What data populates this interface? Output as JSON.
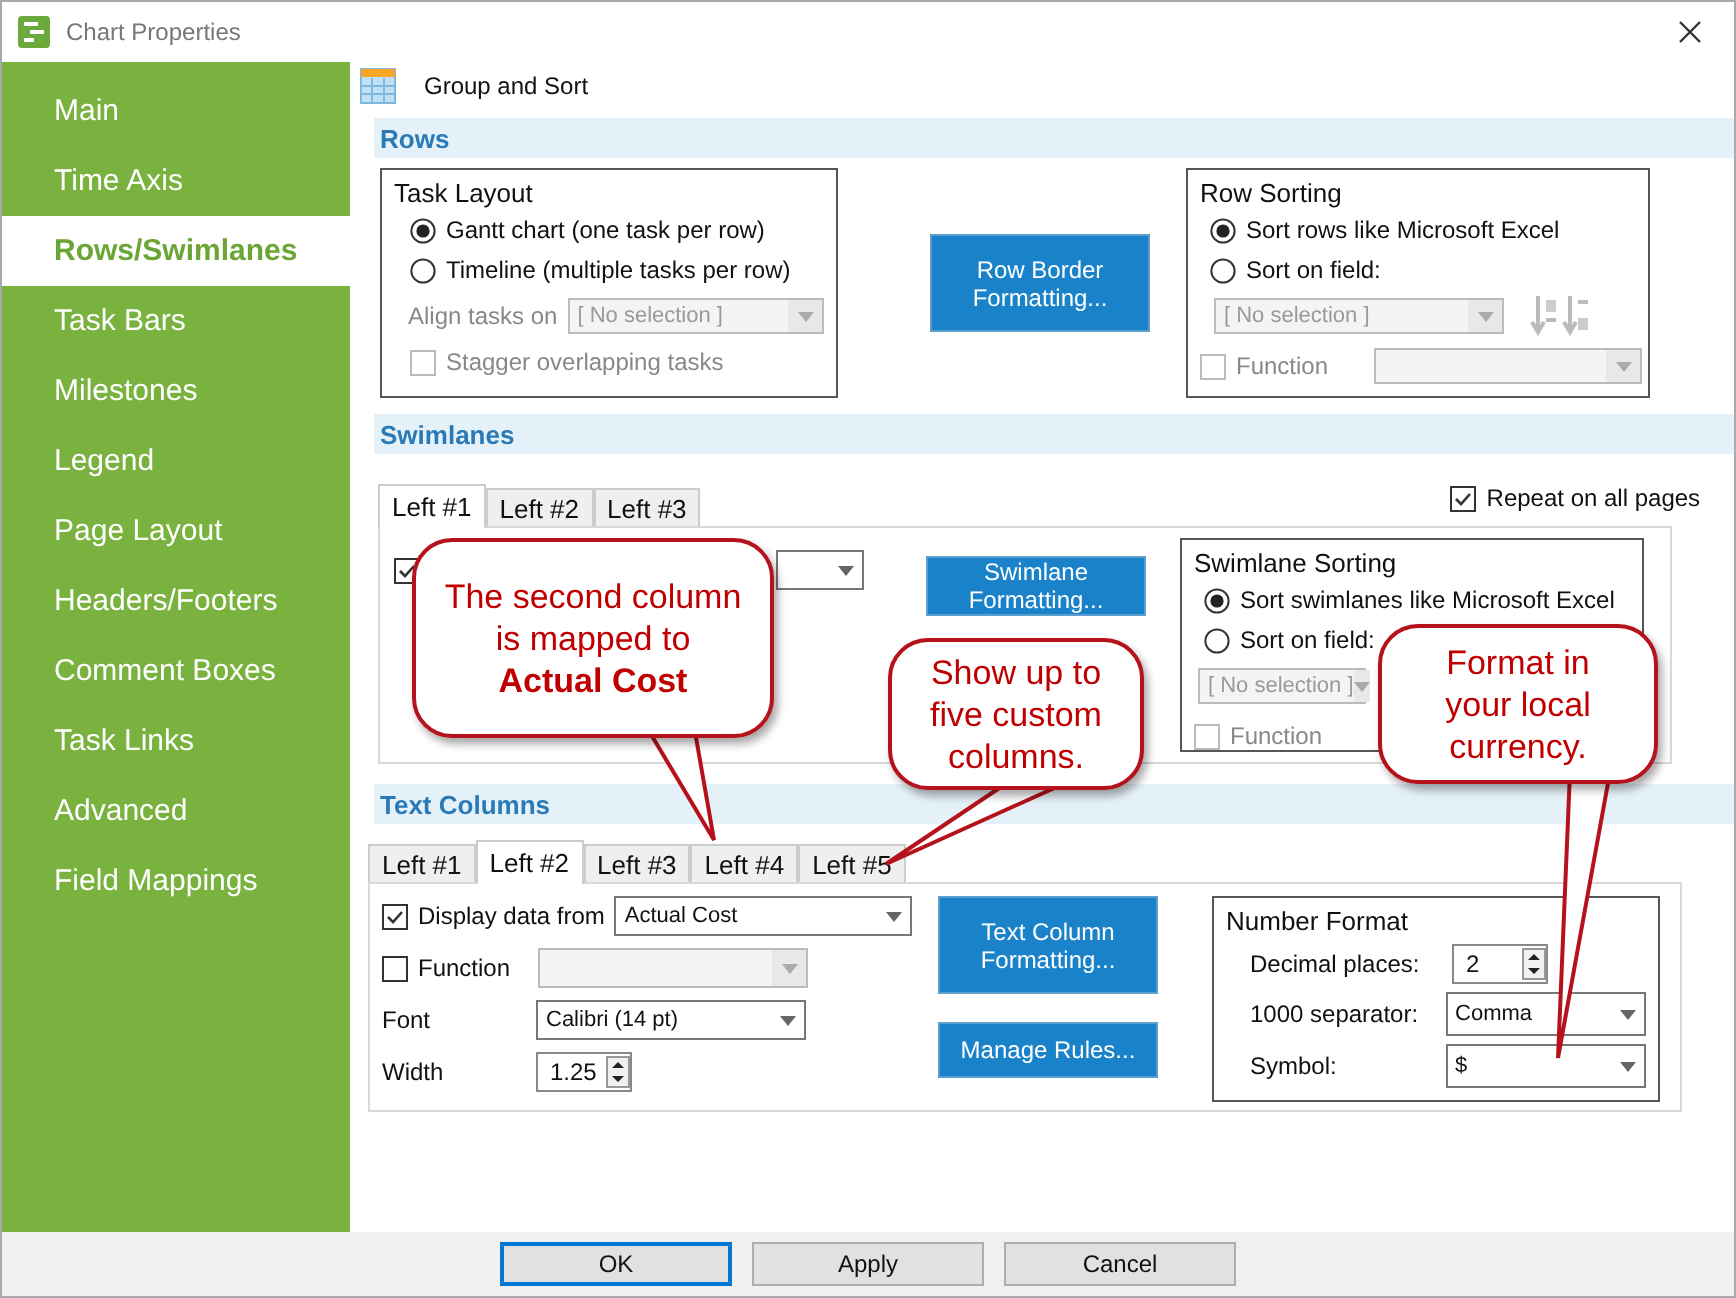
{
  "window": {
    "title": "Chart Properties"
  },
  "sidebar": {
    "items": [
      {
        "label": "Main",
        "selected": false
      },
      {
        "label": "Time Axis",
        "selected": false
      },
      {
        "label": "Rows/Swimlanes",
        "selected": true
      },
      {
        "label": "Task Bars",
        "selected": false
      },
      {
        "label": "Milestones",
        "selected": false
      },
      {
        "label": "Legend",
        "selected": false
      },
      {
        "label": "Page Layout",
        "selected": false
      },
      {
        "label": "Headers/Footers",
        "selected": false
      },
      {
        "label": "Comment Boxes",
        "selected": false
      },
      {
        "label": "Task Links",
        "selected": false
      },
      {
        "label": "Advanced",
        "selected": false
      },
      {
        "label": "Field Mappings",
        "selected": false
      }
    ]
  },
  "page_header": {
    "title": "Group and Sort"
  },
  "rows": {
    "title": "Rows",
    "task_layout": {
      "title": "Task Layout",
      "options": [
        {
          "label": "Gantt chart (one task per row)",
          "selected": true
        },
        {
          "label": "Timeline (multiple tasks per row)",
          "selected": false
        }
      ],
      "align": {
        "label": "Align tasks on",
        "value": "[ No selection ]",
        "disabled": true
      },
      "stagger": {
        "label": "Stagger overlapping tasks",
        "checked": false,
        "disabled": true
      }
    },
    "border_button": "Row Border Formatting...",
    "sorting": {
      "title": "Row Sorting",
      "options": [
        {
          "label": "Sort rows like Microsoft Excel",
          "selected": true
        },
        {
          "label": "Sort on field:",
          "selected": false
        }
      ],
      "field": {
        "value": "[ No selection ]",
        "disabled": true
      },
      "function": {
        "label": "Function",
        "checked": false,
        "disabled": true
      }
    }
  },
  "swimlanes": {
    "title": "Swimlanes",
    "tabs": [
      {
        "label": "Left #1",
        "selected": true
      },
      {
        "label": "Left #2",
        "selected": false
      },
      {
        "label": "Left #3",
        "selected": false
      }
    ],
    "repeat": {
      "label": "Repeat on all pages",
      "checked": true
    },
    "display": {
      "checked": true
    },
    "button": "Swimlane Formatting...",
    "sorting": {
      "title": "Swimlane Sorting",
      "options": [
        {
          "label": "Sort swimlanes like Microsoft Excel",
          "selected": true
        },
        {
          "label": "Sort on field:",
          "selected": false
        }
      ],
      "field": {
        "value": "[ No selection ]",
        "disabled": true
      },
      "function": {
        "label": "Function",
        "checked": false,
        "disabled": true
      }
    }
  },
  "text_columns": {
    "title": "Text Columns",
    "tabs": [
      {
        "label": "Left #1",
        "selected": false
      },
      {
        "label": "Left #2",
        "selected": true
      },
      {
        "label": "Left #3",
        "selected": false
      },
      {
        "label": "Left #4",
        "selected": false
      },
      {
        "label": "Left #5",
        "selected": false
      }
    ],
    "display": {
      "label": "Display data from",
      "checked": true,
      "value": "Actual Cost"
    },
    "function": {
      "label": "Function",
      "checked": false,
      "disabled": true
    },
    "font": {
      "label": "Font",
      "value": "Calibri (14 pt)"
    },
    "width": {
      "label": "Width",
      "value": "1.25"
    },
    "buttons": [
      "Text Column Formatting...",
      "Manage Rules..."
    ],
    "number_format": {
      "title": "Number Format",
      "decimal": {
        "label": "Decimal places:",
        "value": "2"
      },
      "separator": {
        "label": "1000 separator:",
        "value": "Comma"
      },
      "symbol": {
        "label": "Symbol:",
        "value": "$"
      }
    }
  },
  "callouts": [
    {
      "text": "The second column is mapped to **Actual Cost**"
    },
    {
      "text": "Show up to five custom columns."
    },
    {
      "text": "Format in your local currency."
    }
  ],
  "footer": {
    "buttons": [
      {
        "label": "OK",
        "default": true
      },
      {
        "label": "Apply",
        "default": false
      },
      {
        "label": "Cancel",
        "default": false
      }
    ]
  }
}
